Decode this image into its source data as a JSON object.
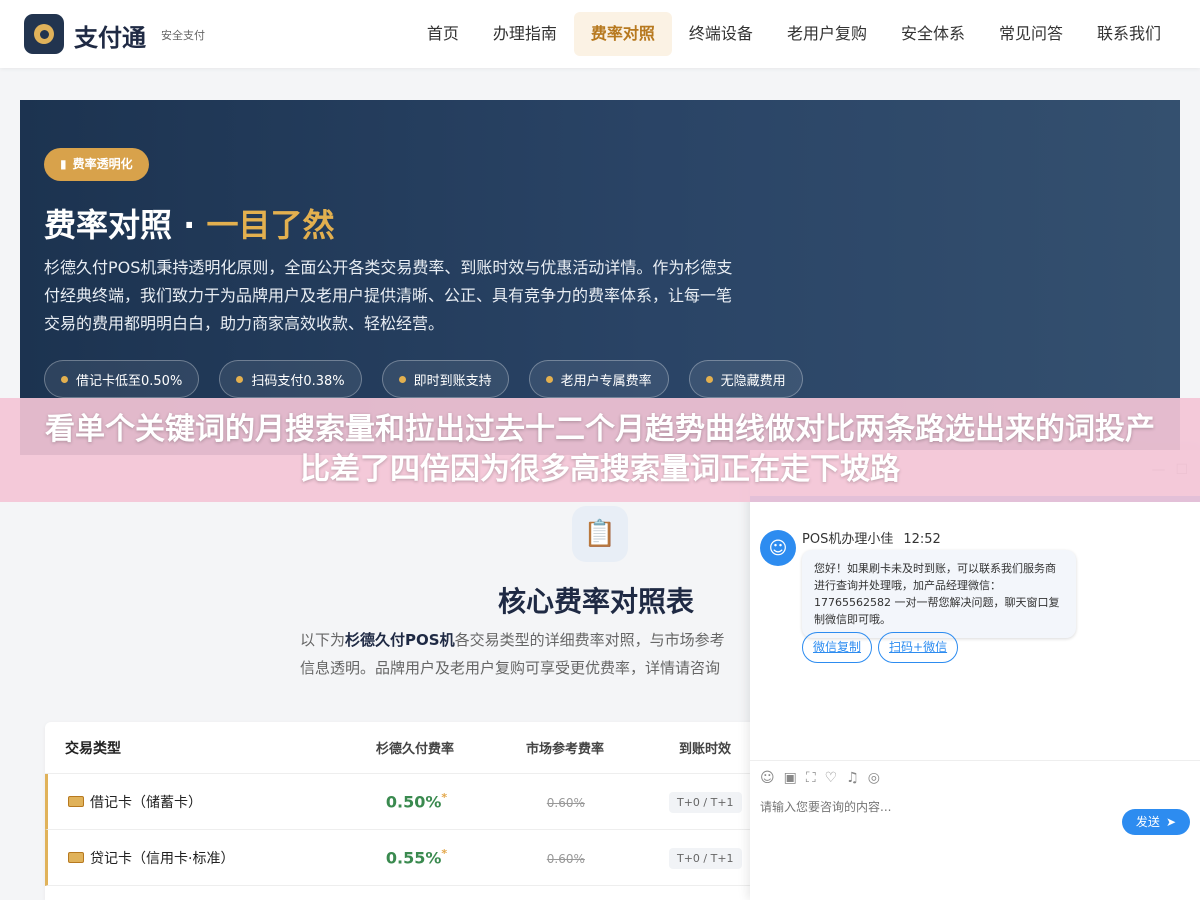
{
  "header": {
    "brand": "支付通",
    "brand_sub": "安全支付",
    "nav": [
      "首页",
      "办理指南",
      "费率对照",
      "终端设备",
      "老用户复购",
      "安全体系",
      "常见问答",
      "联系我们"
    ],
    "active_nav": "费率对照"
  },
  "hero": {
    "badge": "费率透明化",
    "title_main": "费率对照 · ",
    "title_accent": "一目了然",
    "desc": "杉德久付POS机秉持透明化原则，全面公开各类交易费率、到账时效与优惠活动详情。作为杉德支付经典终端，我们致力于为品牌用户及老用户提供清晰、公正、具有竞争力的费率体系，让每一笔交易的费用都明明白白，助力商家高效收款、轻松经营。",
    "pills": [
      "借记卡低至0.50%",
      "扫码支付0.38%",
      "即时到账支持",
      "老用户专属费率",
      "无隐藏费用"
    ]
  },
  "overlay": {
    "text": "看单个关键词的月搜索量和拉出过去十二个月趋势曲线做对比两条路选出来的词投产比差了四倍因为很多高搜索量词正在走下坡路"
  },
  "section": {
    "icon": "clipboard-icon",
    "title": "核心费率对照表",
    "desc_prefix": "以下为",
    "desc_bold": "杉德久付POS机",
    "desc_line1_rest": "各交易类型的详细费率对照，与市场参考",
    "desc_line2": "信息透明。品牌用户及老用户复购可享受更优费率，详情请咨询"
  },
  "table": {
    "headers": [
      "交易类型",
      "杉德久付费率",
      "市场参考费率",
      "到账时效"
    ],
    "rows": [
      {
        "type": "借记卡（储蓄卡）",
        "rate": "0.50%",
        "mark": "*",
        "market": "0.60%",
        "settle": "T+0 / T+1"
      },
      {
        "type": "贷记卡（信用卡·标准）",
        "rate": "0.55%",
        "mark": "*",
        "market": "0.60%",
        "settle": "T+0 / T+1"
      }
    ]
  },
  "chat": {
    "agent_name": "POS机办理小佳",
    "time": "12:52",
    "message": "您好！如果刷卡未及时到账，可以联系我们服务商进行查询并处理哦，加产品经理微信：17765562582 一对一帮您解决问题，聊天窗口复制微信即可哦。",
    "quick_buttons": [
      "微信复制",
      "扫码+微信"
    ],
    "input_placeholder": "请输入您要咨询的内容...",
    "send_label": "发送",
    "accent": "#2d8cf0"
  }
}
